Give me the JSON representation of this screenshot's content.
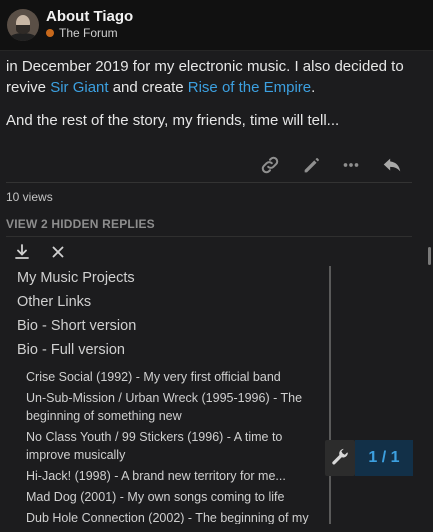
{
  "header": {
    "title": "About Tiago",
    "category": "The Forum",
    "category_color": "#c8691c"
  },
  "post": {
    "line1": "in December 2019 for my electronic music. I also decided to",
    "line2_pre": "revive ",
    "link_sir_giant": "Sir Giant",
    "line2_mid": " and create ",
    "link_rise": "Rise of the Empire",
    "line2_end": ".",
    "para2": "And the rest of the story, my friends, time will tell..."
  },
  "actions": [
    "link-icon",
    "edit-pencil-icon",
    "more-icon",
    "reply-icon"
  ],
  "views": "10 views",
  "hidden_replies": "VIEW 2 HIDDEN REPLIES",
  "toc": {
    "toolbar": [
      "download-icon",
      "close-icon"
    ],
    "h2": [
      "My Music Projects",
      "Other Links",
      "Bio - Short version",
      "Bio - Full version"
    ],
    "h3": [
      "Crise Social (1992) - My very first official band",
      "Un-Sub-Mission / Urban Wreck (1995-1996) - The beginning of something new",
      "No Class Youth / 99 Stickers (1996) - A time to improve musically",
      "Hi-Jack! (1998) - A brand new territory for me...",
      "Mad Dog (2001) - My own songs coming to life",
      "Dub Hole Connection (2002) - The beginning of my"
    ]
  },
  "pager": "1 / 1",
  "colors": {
    "accent": "#3ca0e0",
    "bg": "#1c1c1e"
  }
}
